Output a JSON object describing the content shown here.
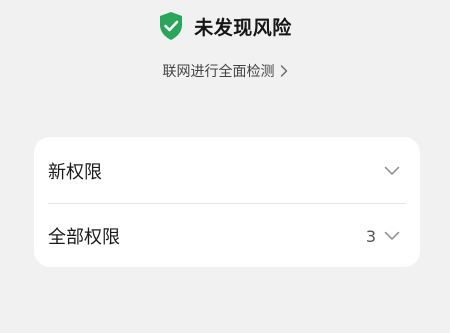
{
  "security_status": {
    "text": "未发现风险",
    "icon": "shield-check-icon",
    "color": "#2aa55a"
  },
  "scan_link": {
    "label": "联网进行全面检测",
    "icon": "chevron-right-icon"
  },
  "permission_groups": [
    {
      "label": "新权限",
      "count": "",
      "icon": "chevron-down-icon"
    },
    {
      "label": "全部权限",
      "count": "3",
      "icon": "chevron-down-icon"
    }
  ]
}
